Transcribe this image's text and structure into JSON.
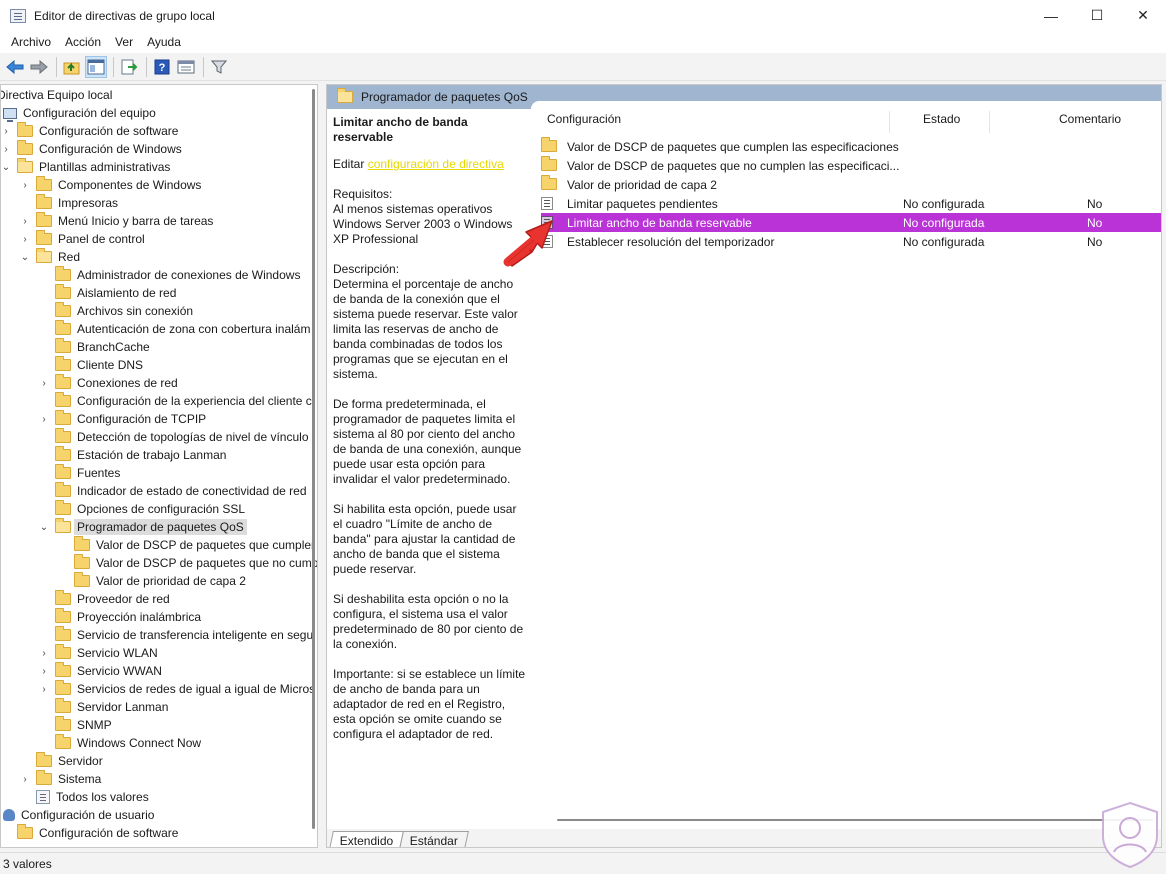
{
  "window": {
    "title": "Editor de directivas de grupo local",
    "min": "—",
    "max": "☐",
    "close": "✕"
  },
  "menu": [
    "Archivo",
    "Acción",
    "Ver",
    "Ayuda"
  ],
  "toolbar": {
    "icons": [
      "back-icon",
      "forward-icon",
      "up-folder-icon",
      "show-hide-tree-icon",
      "export-list-icon",
      "help-icon",
      "properties-icon",
      "filter-icon"
    ]
  },
  "tree": {
    "items": [
      {
        "label": "Directiva Equipo local",
        "icon": "none",
        "chev": ""
      },
      {
        "label": "Configuración del equipo",
        "icon": "pc",
        "chev": ""
      },
      {
        "label": "Configuración de software",
        "icon": "folder",
        "chev": "›"
      },
      {
        "label": "Configuración de Windows",
        "icon": "folder",
        "chev": "›"
      },
      {
        "label": "Plantillas administrativas",
        "icon": "folder",
        "chev": "⌄"
      },
      {
        "label": "Componentes de Windows",
        "icon": "folder",
        "chev": "›"
      },
      {
        "label": "Impresoras",
        "icon": "folder",
        "chev": ""
      },
      {
        "label": "Menú Inicio y barra de tareas",
        "icon": "folder",
        "chev": "›"
      },
      {
        "label": "Panel de control",
        "icon": "folder",
        "chev": "›"
      },
      {
        "label": "Red",
        "icon": "folder",
        "chev": "⌄"
      },
      {
        "label": "Administrador de conexiones de Windows",
        "icon": "folder",
        "chev": ""
      },
      {
        "label": "Aislamiento de red",
        "icon": "folder",
        "chev": ""
      },
      {
        "label": "Archivos sin conexión",
        "icon": "folder",
        "chev": ""
      },
      {
        "label": "Autenticación de zona con cobertura inalám",
        "icon": "folder",
        "chev": ""
      },
      {
        "label": "BranchCache",
        "icon": "folder",
        "chev": ""
      },
      {
        "label": "Cliente DNS",
        "icon": "folder",
        "chev": ""
      },
      {
        "label": "Conexiones de red",
        "icon": "folder",
        "chev": "›"
      },
      {
        "label": "Configuración de la experiencia del cliente c",
        "icon": "folder",
        "chev": ""
      },
      {
        "label": "Configuración de TCPIP",
        "icon": "folder",
        "chev": "›"
      },
      {
        "label": "Detección de topologías de nivel de vínculo",
        "icon": "folder",
        "chev": ""
      },
      {
        "label": "Estación de trabajo Lanman",
        "icon": "folder",
        "chev": ""
      },
      {
        "label": "Fuentes",
        "icon": "folder",
        "chev": ""
      },
      {
        "label": "Indicador de estado de conectividad de red",
        "icon": "folder",
        "chev": ""
      },
      {
        "label": "Opciones de configuración SSL",
        "icon": "folder",
        "chev": ""
      },
      {
        "label": "Programador de paquetes QoS",
        "icon": "folder-open",
        "chev": "⌄",
        "selected": true
      },
      {
        "label": "Valor de DSCP de paquetes que cumpler",
        "icon": "folder",
        "chev": ""
      },
      {
        "label": "Valor de DSCP de paquetes que no cump",
        "icon": "folder",
        "chev": ""
      },
      {
        "label": "Valor de prioridad de capa 2",
        "icon": "folder",
        "chev": ""
      },
      {
        "label": "Proveedor de red",
        "icon": "folder",
        "chev": ""
      },
      {
        "label": "Proyección inalámbrica",
        "icon": "folder",
        "chev": ""
      },
      {
        "label": "Servicio de transferencia inteligente en segu",
        "icon": "folder",
        "chev": ""
      },
      {
        "label": "Servicio WLAN",
        "icon": "folder",
        "chev": "›"
      },
      {
        "label": "Servicio WWAN",
        "icon": "folder",
        "chev": "›"
      },
      {
        "label": "Servicios de redes de igual a igual de Micros",
        "icon": "folder",
        "chev": "›"
      },
      {
        "label": "Servidor Lanman",
        "icon": "folder",
        "chev": ""
      },
      {
        "label": "SNMP",
        "icon": "folder",
        "chev": ""
      },
      {
        "label": "Windows Connect Now",
        "icon": "folder",
        "chev": ""
      },
      {
        "label": "Servidor",
        "icon": "folder",
        "chev": ""
      },
      {
        "label": "Sistema",
        "icon": "folder",
        "chev": "›"
      },
      {
        "label": "Todos los valores",
        "icon": "all",
        "chev": ""
      },
      {
        "label": "Configuración de usuario",
        "icon": "user",
        "chev": ""
      },
      {
        "label": "Configuración de software",
        "icon": "folder",
        "chev": ""
      }
    ]
  },
  "right": {
    "header": "Programador de paquetes QoS",
    "desc": {
      "title": "Limitar ancho de banda reservable",
      "edit_prefix": "Editar ",
      "edit_link": "configuración de directiva",
      "req_label": "Requisitos:",
      "req_text": "Al menos sistemas operativos Windows Server 2003 o Windows XP Professional",
      "desc_label": "Descripción:",
      "p1": "Determina el porcentaje de ancho de banda de la conexión que el sistema puede reservar. Este valor limita las reservas de ancho de banda combinadas de todos los programas que se ejecutan en el sistema.",
      "p2": "De forma predeterminada, el programador de paquetes limita el sistema al 80 por ciento del ancho de banda de una conexión, aunque puede usar esta opción para invalidar el valor predeterminado.",
      "p3": "Si habilita esta opción, puede usar el cuadro \"Límite de ancho de banda\" para ajustar la cantidad de ancho de banda que el sistema puede reservar.",
      "p4": "Si deshabilita esta opción o no la configura, el sistema usa el valor predeterminado de 80 por ciento de la conexión.",
      "p5": "Importante: si se establece un límite de ancho de banda para un adaptador de red en el Registro, esta opción se omite cuando se configura el adaptador de red."
    },
    "columns": [
      "Configuración",
      "Estado",
      "Comentario"
    ],
    "rows": [
      {
        "name": "Valor de DSCP de paquetes que cumplen las especificaciones",
        "estado": "",
        "comentario": "",
        "type": "folder"
      },
      {
        "name": "Valor de DSCP de paquetes que no cumplen las especificaci...",
        "estado": "",
        "comentario": "",
        "type": "folder"
      },
      {
        "name": "Valor de prioridad de capa 2",
        "estado": "",
        "comentario": "",
        "type": "folder"
      },
      {
        "name": "Limitar paquetes pendientes",
        "estado": "No configurada",
        "comentario": "No",
        "type": "setting"
      },
      {
        "name": "Limitar ancho de banda reservable",
        "estado": "No configurada",
        "comentario": "No",
        "type": "setting",
        "selected": true
      },
      {
        "name": "Establecer resolución del temporizador",
        "estado": "No configurada",
        "comentario": "No",
        "type": "setting"
      }
    ],
    "tabs": [
      "Extendido",
      "Estándar"
    ]
  },
  "status": "3 valores",
  "colors": {
    "selection": "#b933d6",
    "header": "#9fb5d0",
    "link": "#e6d800",
    "annotation": "#e8332f"
  }
}
